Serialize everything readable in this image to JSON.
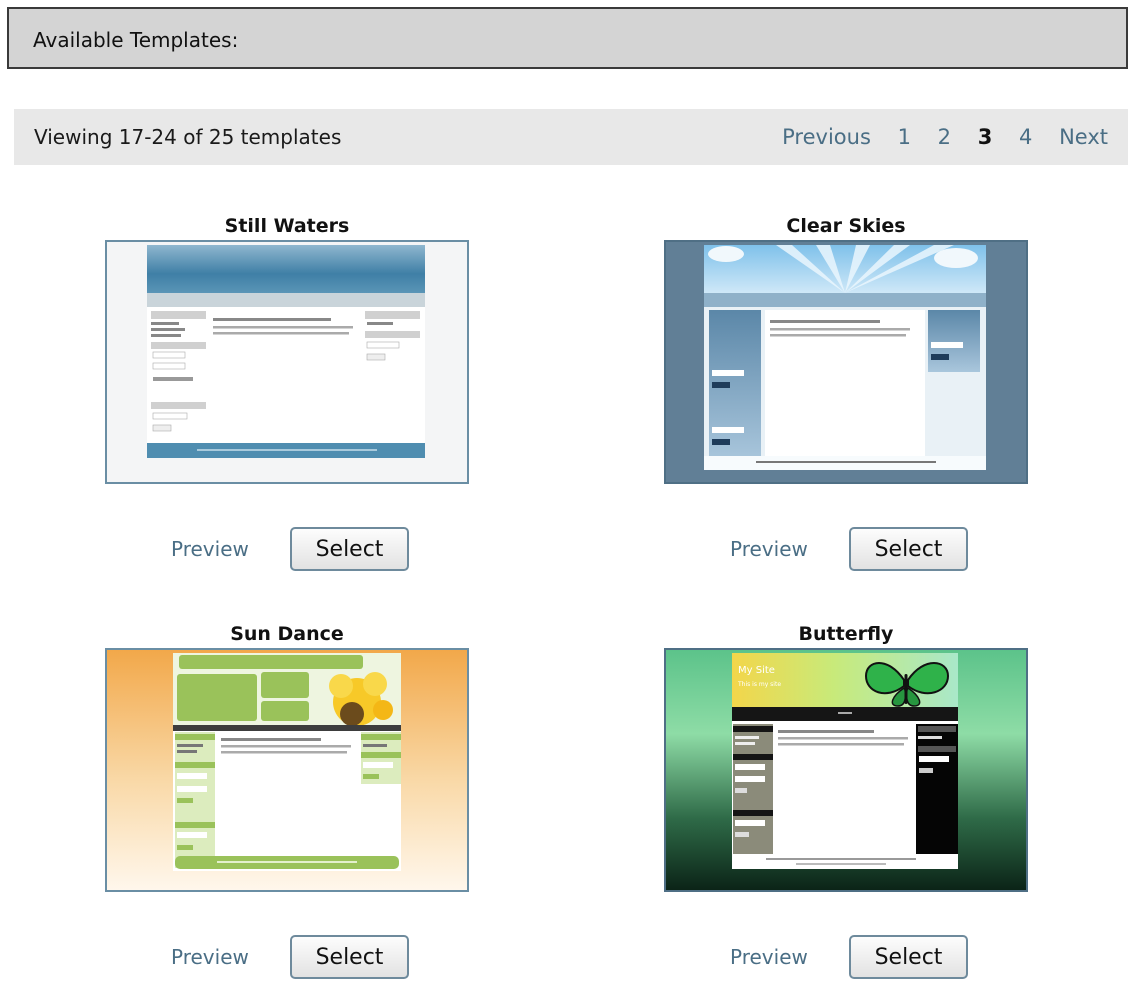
{
  "header": {
    "title": "Available Templates:"
  },
  "pager": {
    "viewing_text": "Viewing 17-24 of 25 templates",
    "previous_label": "Previous",
    "pages": [
      "1",
      "2",
      "3",
      "4"
    ],
    "current_page": "3",
    "next_label": "Next"
  },
  "templates": [
    {
      "name": "Still Waters",
      "preview_label": "Preview",
      "select_label": "Select"
    },
    {
      "name": "Clear Skies",
      "preview_label": "Preview",
      "select_label": "Select"
    },
    {
      "name": "Sun Dance",
      "preview_label": "Preview",
      "select_label": "Select"
    },
    {
      "name": "Butterfly",
      "preview_label": "Preview",
      "select_label": "Select",
      "thumb_text": [
        "My Site",
        "This is my site"
      ]
    }
  ],
  "colors": {
    "link": "#4a6e85",
    "header_bg": "#d4d4d4",
    "pager_bg": "#e8e8e8",
    "thumb_border": "#58788c"
  }
}
